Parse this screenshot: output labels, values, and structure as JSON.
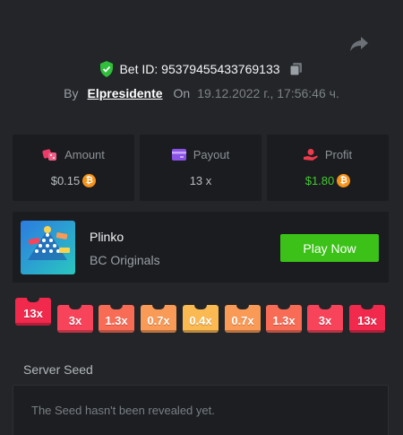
{
  "bet": {
    "id_text": "Bet ID: 95379455433769133",
    "by_label": "By",
    "username": "Elpresidente",
    "on_label": "On",
    "date": "19.12.2022 г., 17:56:46 ч."
  },
  "stats": [
    {
      "label": "Amount",
      "value": "$0.15",
      "icon": "dice-icon",
      "currency": "bitcoin-icon"
    },
    {
      "label": "Payout",
      "value": "13 x",
      "icon": "payout-card-icon"
    },
    {
      "label": "Profit",
      "value": "$1.80",
      "icon": "profit-hand-icon",
      "currency": "bitcoin-icon"
    }
  ],
  "game": {
    "name": "Plinko",
    "provider": "BC Originals",
    "thumb_label": "PLINKO",
    "play_label": "Play Now"
  },
  "multipliers": [
    {
      "label": "13x",
      "color": "#f0294d",
      "hit": true
    },
    {
      "label": "3x",
      "color": "#f7445a"
    },
    {
      "label": "1.3x",
      "color": "#f86c56"
    },
    {
      "label": "0.7x",
      "color": "#f99a56"
    },
    {
      "label": "0.4x",
      "color": "#fbb952"
    },
    {
      "label": "0.7x",
      "color": "#f99a56"
    },
    {
      "label": "1.3x",
      "color": "#f86c56"
    },
    {
      "label": "3x",
      "color": "#f7445a"
    },
    {
      "label": "13x",
      "color": "#f0294d"
    }
  ],
  "seed": {
    "label": "Server Seed",
    "text": "The Seed hasn't been revealed yet."
  },
  "colors": {
    "background": "#232528",
    "panel": "#1a1c1f",
    "accent_green": "#3bc117",
    "profit_green": "#44c832",
    "bitcoin": "#f7931a"
  }
}
